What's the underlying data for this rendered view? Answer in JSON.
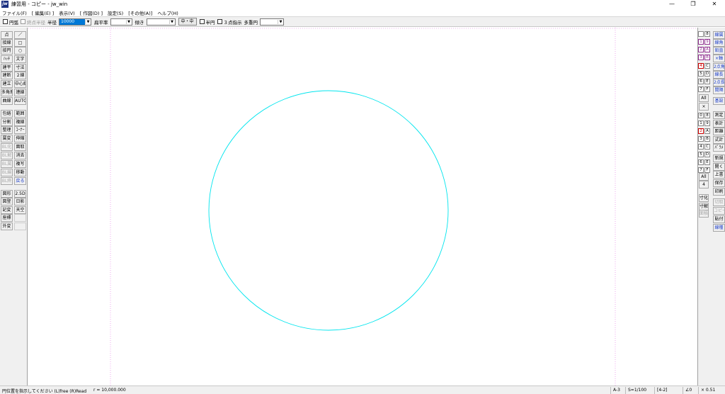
{
  "window": {
    "title": "練習用 - コピー - jw_win",
    "icon": "jw"
  },
  "menu": [
    "ファイル(F)",
    "[ 編集(E) ]",
    "表示(V)",
    "[ 作図(D) ]",
    "設定(S)",
    "[その他(A)]",
    "ヘルプ(H)"
  ],
  "toolbar": {
    "circle_check_label": "円弧",
    "tangent_label": "終点半径",
    "radius_label": "半径",
    "radius_value": "10000",
    "flatten_label": "扁平率",
    "flatten_value": "",
    "tilt_label": "傾き",
    "tilt_value": "",
    "center_button": "中・中",
    "half_circle_label": "半円",
    "three_point_label": "３点指示",
    "multi_circle_label": "多重円",
    "multi_circle_value": ""
  },
  "left_tools": [
    [
      "点",
      "／"
    ],
    [
      "接線",
      "□"
    ],
    [
      "接円",
      "○"
    ],
    [
      "ﾊｯﾁ",
      "文字"
    ],
    [
      "建平",
      "寸法"
    ],
    [
      "建断",
      "２線"
    ],
    [
      "建立",
      "中心線"
    ],
    [
      "多角形",
      "連線"
    ],
    [
      "曲線",
      "AUTO"
    ],
    [
      "包絡",
      "範囲"
    ],
    [
      "分割",
      "複線"
    ],
    [
      "整理",
      "ｺｰﾅｰ"
    ],
    [
      "属変",
      "伸縮"
    ],
    [
      "BL化",
      "面取"
    ],
    [
      "BL解",
      "消去"
    ],
    [
      "BL属",
      "複写"
    ],
    [
      "BL編",
      "移動"
    ],
    [
      "BL終",
      "戻る"
    ],
    [
      "図形",
      "2.5D"
    ],
    [
      "図登",
      "日影"
    ],
    [
      "記変",
      "天空"
    ],
    [
      "座標",
      ""
    ],
    [
      "外変",
      ""
    ]
  ],
  "right_layer_labels": [
    "0",
    "1",
    "2",
    "3",
    "4",
    "5",
    "6",
    "7",
    "8",
    "9",
    "A",
    "B",
    "C",
    "D",
    "E",
    "F"
  ],
  "right_layer_all": "All",
  "right_tools_top": [
    "線属",
    "線角",
    "鉛直",
    "×軸",
    "2点角",
    "線長",
    "2点長",
    "間隔",
    "基設"
  ],
  "right_group_labels": [
    "0",
    "1",
    "2",
    "3",
    "4",
    "5",
    "6",
    "7",
    "8",
    "9",
    "A",
    "B",
    "C",
    "D",
    "E",
    "F"
  ],
  "right_group_all": "All",
  "right_group_num": "4",
  "right_tools_mid": [
    "測定",
    "表計",
    "距離",
    "式計",
    "ﾊﾟﾗﾒ"
  ],
  "right_tools_file": [
    "新規",
    "開く",
    "上書",
    "保存",
    "印刷"
  ],
  "right_tools_bottom": [
    "寸化",
    "寸解",
    "切取",
    "コピー",
    "貼付",
    "線種"
  ],
  "right_tools_bottom_left": [
    "寸化",
    "寸解",
    "面積"
  ],
  "status": {
    "message": "円位置を指示してください (L)free (R)Read",
    "radius": "r = 10,000.000",
    "paper": "A-3",
    "scale": "S=1/100",
    "layer": "[4-2]",
    "angle": "∠0",
    "zoom": "× 0.51"
  },
  "colors": {
    "circle": "#00e5ee",
    "guide": "#e070e0",
    "selection": "#0078d7"
  }
}
